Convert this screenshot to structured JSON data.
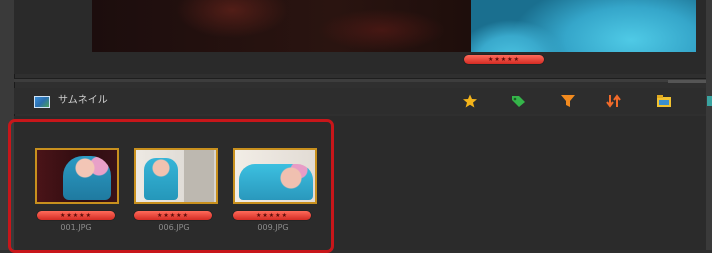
{
  "viewer": {
    "rating_stars": "★★★★★"
  },
  "panel": {
    "title": "サムネイル",
    "icons": [
      "star-icon",
      "tag-icon",
      "filter-icon",
      "sort-icon",
      "folder-icon"
    ]
  },
  "thumbnails": [
    {
      "filename": "001.JPG",
      "rating": "★★★★★"
    },
    {
      "filename": "006.JPG",
      "rating": "★★★★★"
    },
    {
      "filename": "009.JPG",
      "rating": "★★★★★"
    }
  ],
  "colors": {
    "highlight": "#c8161a",
    "rating": "#e0382f",
    "thumb_border": "#c8901e"
  }
}
